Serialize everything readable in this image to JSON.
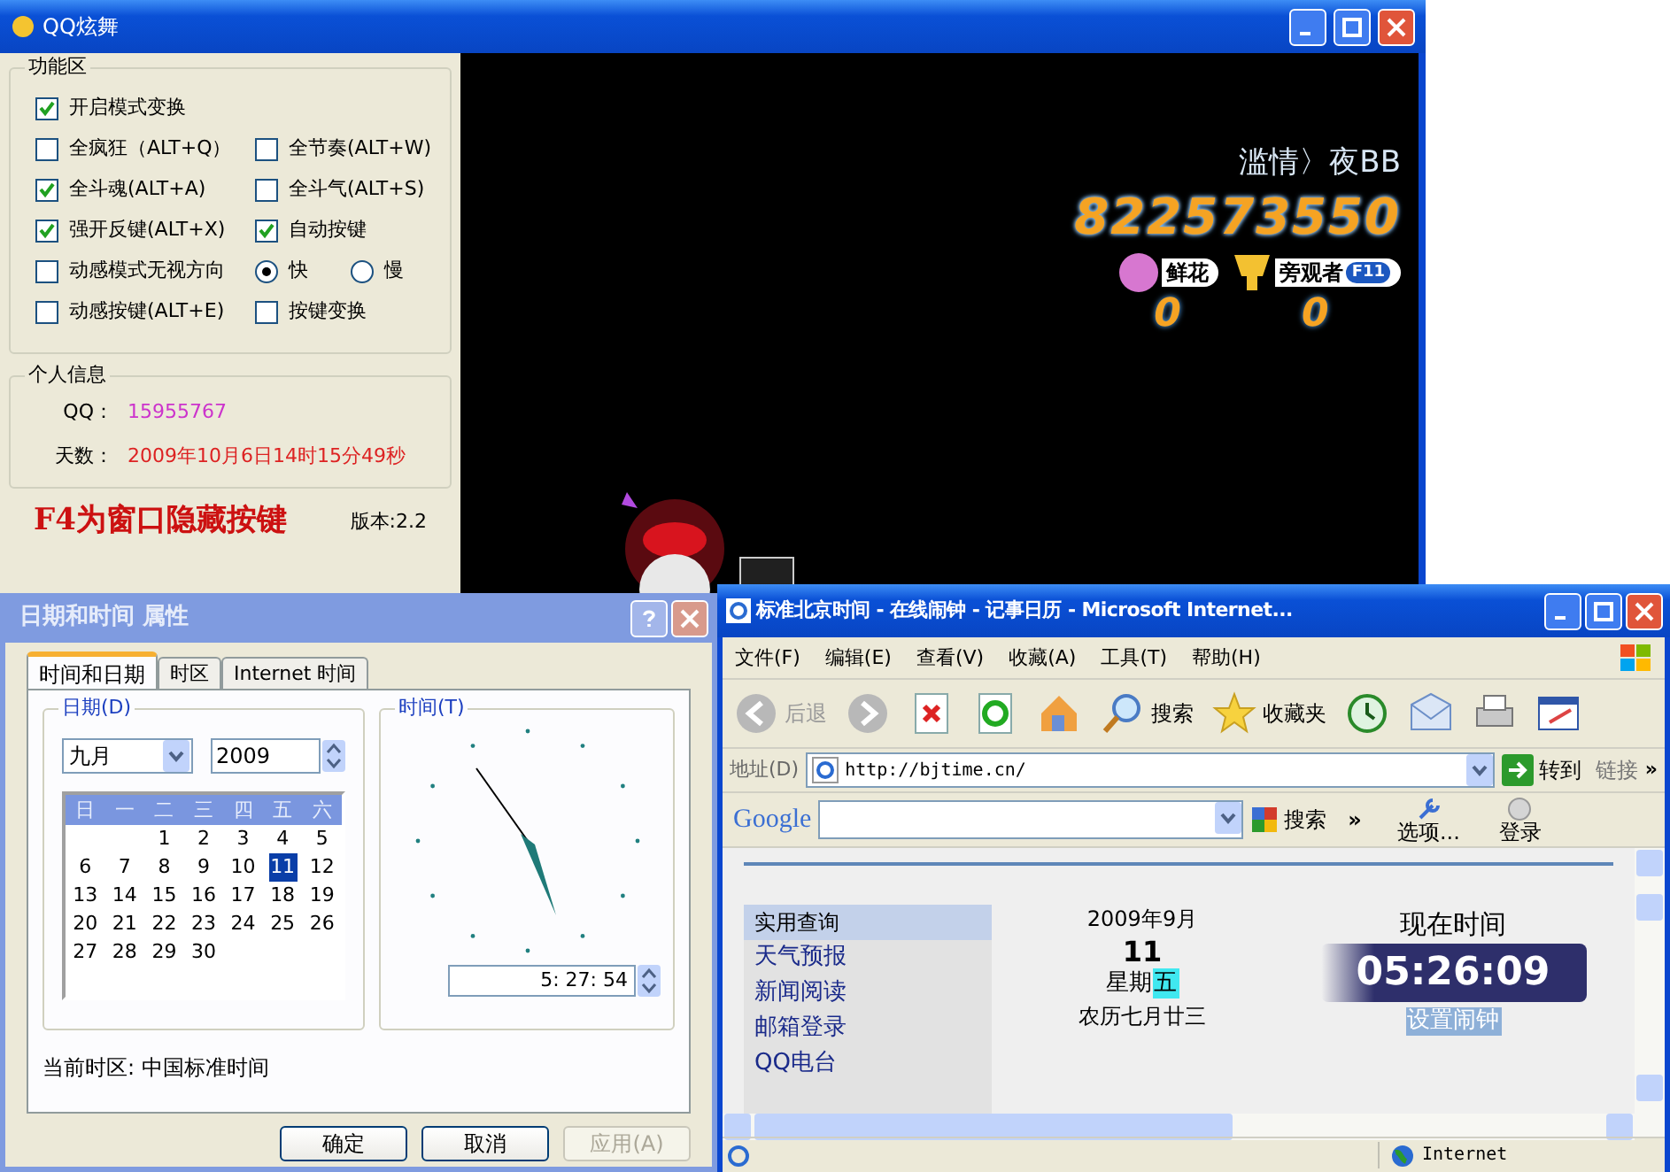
{
  "qq_window": {
    "title": "QQ炫舞",
    "function_area": {
      "legend": "功能区",
      "rows": [
        [
          {
            "kind": "checkbox",
            "label": "开启模式变换",
            "checked": true
          }
        ],
        [
          {
            "kind": "checkbox",
            "label": "全疯狂（ALT+Q）",
            "checked": false
          },
          {
            "kind": "checkbox",
            "label": "全节奏(ALT+W)",
            "checked": false
          }
        ],
        [
          {
            "kind": "checkbox",
            "label": "全斗魂(ALT+A)",
            "checked": true
          },
          {
            "kind": "checkbox",
            "label": "全斗气(ALT+S)",
            "checked": false
          }
        ],
        [
          {
            "kind": "checkbox",
            "label": "强开反键(ALT+X)",
            "checked": true
          },
          {
            "kind": "checkbox",
            "label": "自动按键",
            "checked": true
          }
        ],
        [
          {
            "kind": "checkbox",
            "label": "动感模式无视方向",
            "checked": false
          },
          {
            "kind": "radio",
            "label": "快",
            "selected": true
          },
          {
            "kind": "radio",
            "label": "慢",
            "selected": false
          }
        ],
        [
          {
            "kind": "checkbox",
            "label": "动感按键(ALT+E)",
            "checked": false
          },
          {
            "kind": "checkbox",
            "label": "按键变换",
            "checked": false
          }
        ]
      ]
    },
    "personal_info": {
      "legend": "个人信息",
      "fields": [
        {
          "label": "QQ：",
          "value": "15955767",
          "color": "#cc33cc"
        },
        {
          "label": "天数：",
          "value": "2009年10月6日14时15分49秒",
          "color": "#dd2222"
        }
      ]
    },
    "hotkey_hint": "F4为窗口隐藏按键",
    "version": "版本:2.2",
    "game": {
      "player_name": "滥情〉夜BB",
      "score": "822573550",
      "badges": [
        {
          "label": "鲜花",
          "count": "0"
        },
        {
          "label": "旁观者",
          "key": "F11",
          "count": "0"
        }
      ]
    }
  },
  "date_dialog": {
    "title": "日期和时间 属性",
    "tabs": [
      {
        "label": "时间和日期",
        "selected": true
      },
      {
        "label": "时区",
        "selected": false
      },
      {
        "label": "Internet 时间",
        "selected": false
      }
    ],
    "date_group": {
      "legend": "日期(D)",
      "month": "九月",
      "year": "2009",
      "weekdays": [
        "日",
        "一",
        "二",
        "三",
        "四",
        "五",
        "六"
      ],
      "weeks": [
        [
          {
            "kind": "empty"
          },
          {
            "kind": "empty"
          },
          {
            "kind": "day",
            "day": "1",
            "selected": false
          },
          {
            "day": "2",
            "selected": false
          },
          {
            "day": "3",
            "selected": false
          },
          {
            "day": "4",
            "selected": false
          },
          {
            "day": "5",
            "selected": false
          }
        ],
        [
          {
            "day": "6",
            "selected": false
          },
          {
            "day": "7",
            "selected": false
          },
          {
            "day": "8",
            "selected": false
          },
          {
            "day": "9",
            "selected": false
          },
          {
            "day": "10",
            "selected": false
          },
          {
            "day": "11",
            "selected": true
          },
          {
            "day": "12",
            "selected": false
          }
        ],
        [
          {
            "day": "13",
            "selected": false
          },
          {
            "day": "14",
            "selected": false
          },
          {
            "day": "15",
            "selected": false
          },
          {
            "day": "16",
            "selected": false
          },
          {
            "day": "17",
            "selected": false
          },
          {
            "day": "18",
            "selected": false
          },
          {
            "day": "19",
            "selected": false
          }
        ],
        [
          {
            "day": "20",
            "selected": false
          },
          {
            "day": "21",
            "selected": false
          },
          {
            "day": "22",
            "selected": false
          },
          {
            "day": "23",
            "selected": false
          },
          {
            "day": "24",
            "selected": false
          },
          {
            "day": "25",
            "selected": false
          },
          {
            "day": "26",
            "selected": false
          }
        ],
        [
          {
            "day": "27",
            "selected": false
          },
          {
            "day": "28",
            "selected": false
          },
          {
            "day": "29",
            "selected": false
          },
          {
            "day": "30",
            "selected": false
          }
        ]
      ]
    },
    "time_group": {
      "legend": "时间(T)",
      "time": "5: 27: 54"
    },
    "timezone": "当前时区: 中国标准时间",
    "buttons": [
      {
        "label": "确定",
        "disabled": false
      },
      {
        "label": "取消",
        "disabled": false
      },
      {
        "label": "应用(A)",
        "disabled": true
      }
    ]
  },
  "ie_window": {
    "title": "标准北京时间 - 在线闹钟 - 记事日历 - Microsoft Internet...",
    "menu": [
      "文件(F)",
      "编辑(E)",
      "查看(V)",
      "收藏(A)",
      "工具(T)",
      "帮助(H)"
    ],
    "toolbar": {
      "back": "后退",
      "search": "搜索",
      "favorites": "收藏夹"
    },
    "address": {
      "label": "地址(D)",
      "url": "http://bjtime.cn/",
      "go": "转到",
      "links": "链接",
      "more": "»"
    },
    "google_bar": {
      "logo": "Google",
      "search": "搜索",
      "more": "»",
      "options": "选项...",
      "login": "登录"
    },
    "page": {
      "sidebar_heading": "实用查询",
      "sidebar_links": [
        "天气预报",
        "新闻阅读",
        "邮箱登录",
        "QQ电台"
      ],
      "month": "2009年9月",
      "day": "11",
      "weekday_prefix": "星期",
      "weekday": "五",
      "lunar": "农历七月廿三",
      "clock_heading": "现在时间",
      "clock": "05:26:09",
      "alarm_link": "设置闹钟"
    },
    "status_zone": "Internet"
  }
}
